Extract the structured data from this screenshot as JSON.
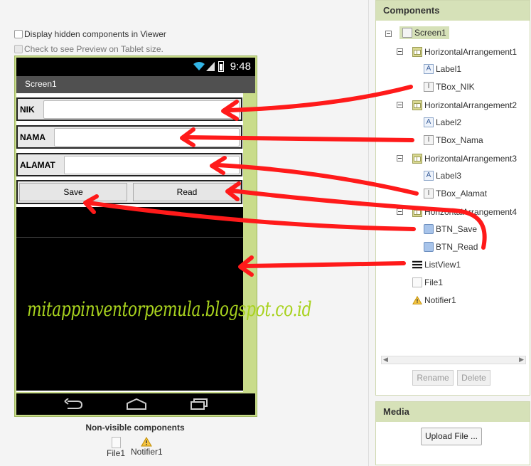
{
  "viewer": {
    "display_hidden_label": "Display hidden components in Viewer",
    "tablet_preview_label": "Check to see Preview on Tablet size."
  },
  "phone": {
    "time": "9:48",
    "screen_title": "Screen1",
    "fields": [
      {
        "label": "NIK"
      },
      {
        "label": "NAMA"
      },
      {
        "label": "ALAMAT"
      }
    ],
    "buttons": {
      "save": "Save",
      "read": "Read"
    }
  },
  "non_visible": {
    "title": "Non-visible components",
    "items": [
      {
        "label": "File1",
        "icon": "file-icon"
      },
      {
        "label": "Notifier1",
        "icon": "warning-icon"
      }
    ]
  },
  "watermark": "mitappinventorpemula.blogspot.co.id",
  "components": {
    "title": "Components",
    "tree": [
      {
        "label": "Screen1",
        "icon": "screen-icon"
      },
      {
        "label": "HorizontalArrangement1",
        "icon": "horizontal-arrangement-icon"
      },
      {
        "label": "Label1",
        "icon": "label-icon"
      },
      {
        "label": "TBox_NIK",
        "icon": "textbox-icon"
      },
      {
        "label": "HorizontalArrangement2",
        "icon": "horizontal-arrangement-icon"
      },
      {
        "label": "Label2",
        "icon": "label-icon"
      },
      {
        "label": "TBox_Nama",
        "icon": "textbox-icon"
      },
      {
        "label": "HorizontalArrangement3",
        "icon": "horizontal-arrangement-icon"
      },
      {
        "label": "Label3",
        "icon": "label-icon"
      },
      {
        "label": "TBox_Alamat",
        "icon": "textbox-icon"
      },
      {
        "label": "HorizontalArrangement4",
        "icon": "horizontal-arrangement-icon"
      },
      {
        "label": "BTN_Save",
        "icon": "button-icon"
      },
      {
        "label": "BTN_Read",
        "icon": "button-icon"
      },
      {
        "label": "ListView1",
        "icon": "listview-icon"
      },
      {
        "label": "File1",
        "icon": "file-icon"
      },
      {
        "label": "Notifier1",
        "icon": "warning-icon"
      }
    ],
    "rename_label": "Rename",
    "delete_label": "Delete"
  },
  "media": {
    "title": "Media",
    "upload_label": "Upload File ..."
  },
  "colors": {
    "phone_frame": "#c9dc8a",
    "panel_header": "#d6e1b8",
    "annotation_arrow": "#ff0000",
    "watermark": "#a8d21e"
  }
}
